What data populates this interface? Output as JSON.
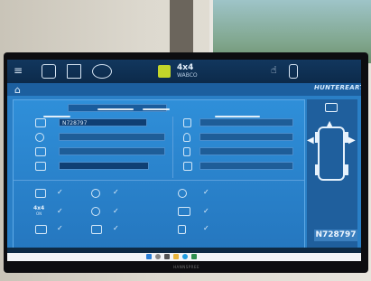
{
  "header": {
    "mode_main": "4x4",
    "mode_sub": "WABCO",
    "icons": [
      "menu-icon",
      "camera-icon",
      "axle-icon",
      "wheel-target-icon",
      "brand-badge-icon",
      "hand-gesture-icon",
      "trash-icon"
    ]
  },
  "subbar": {
    "home_icon": "⌂",
    "logo": "HUNTEREARTH"
  },
  "vehicle": {
    "plate": "N728797",
    "fields": [
      "N728797",
      "",
      "",
      ""
    ]
  },
  "status_checks": {
    "left_labels": [
      "",
      "4x4",
      ""
    ],
    "left_sub": [
      "",
      "ON",
      ""
    ],
    "mark": "✓"
  },
  "taskbar": {
    "time": "",
    "brand": "HANNSPREE"
  },
  "colors": {
    "screen_bg": "#2a7fc6",
    "topbar": "#0c2a4a",
    "accent": "#c3d62a"
  }
}
